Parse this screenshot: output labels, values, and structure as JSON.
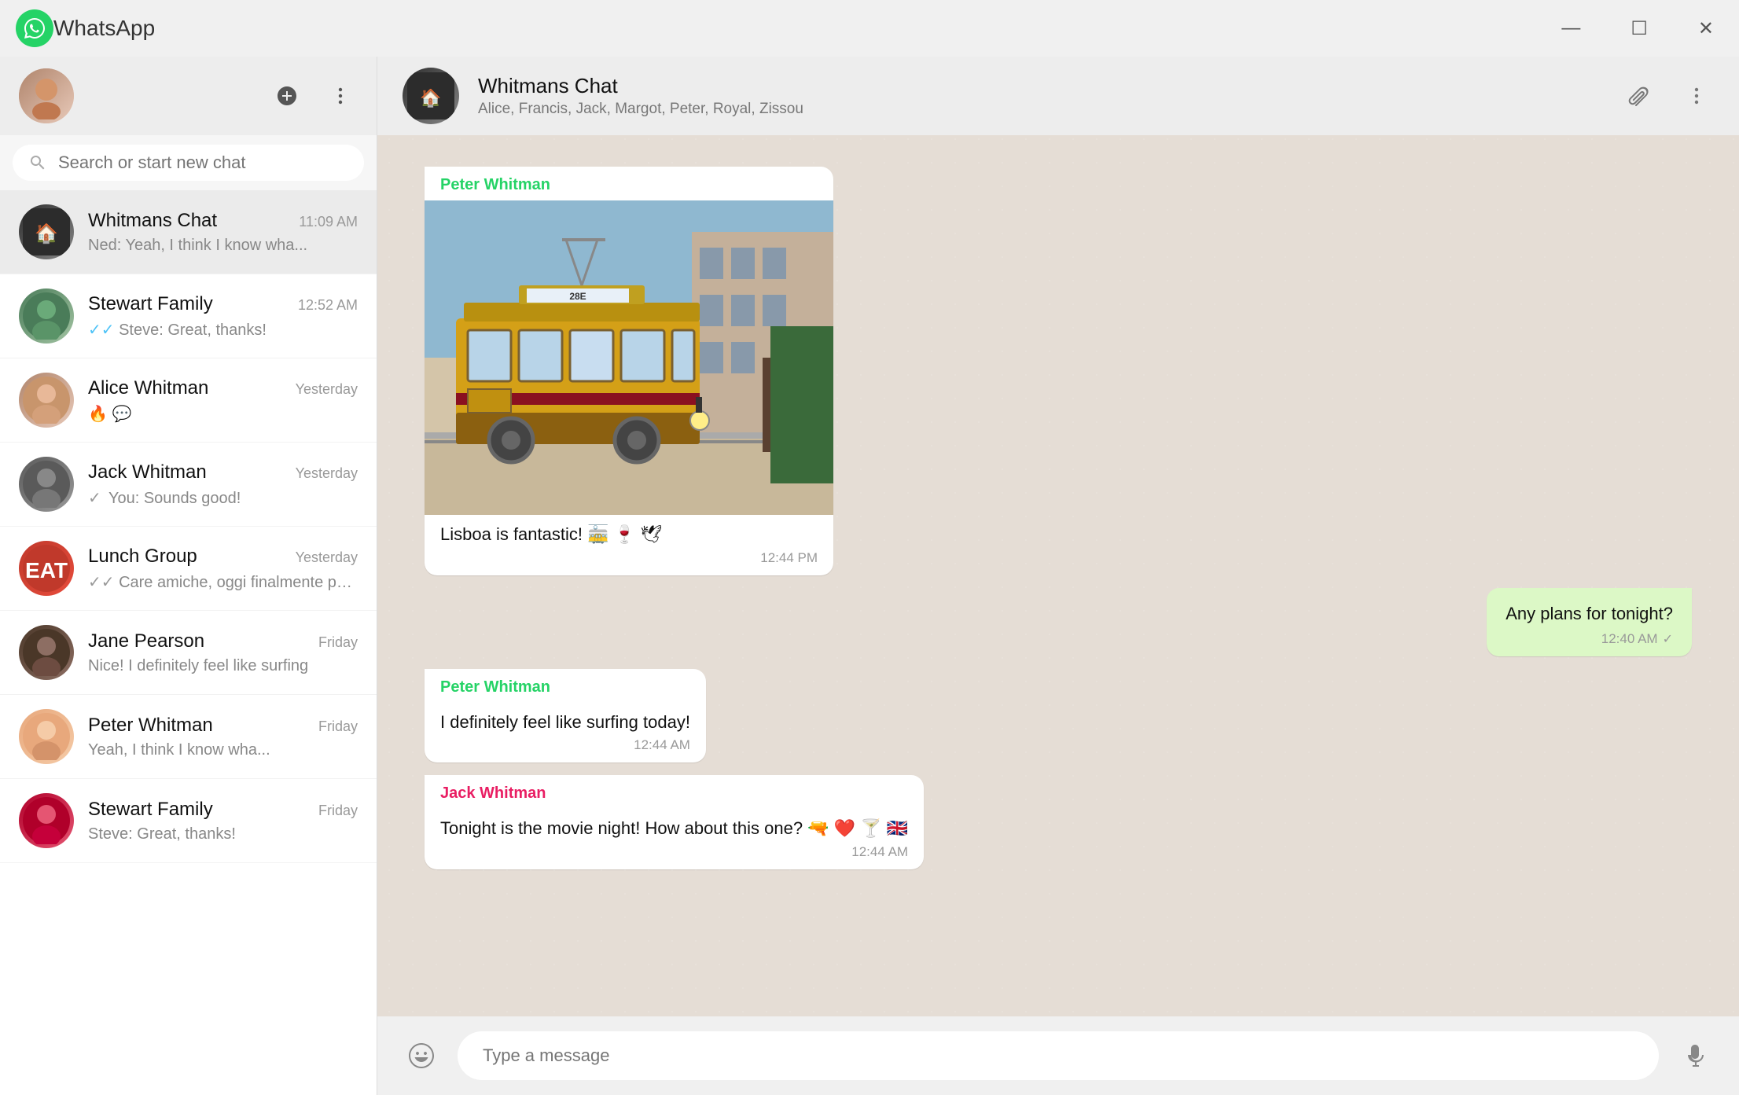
{
  "titlebar": {
    "title": "WhatsApp",
    "minimize": "—",
    "maximize": "☐",
    "close": "✕"
  },
  "sidebar": {
    "search_placeholder": "Search or start new chat",
    "new_chat_icon": "+",
    "more_icon": "···",
    "chats": [
      {
        "id": "whitmans",
        "name": "Whitmans Chat",
        "time": "11:09 AM",
        "preview": "Ned: Yeah, I think I know wha...",
        "tick": "none",
        "active": true
      },
      {
        "id": "stewart",
        "name": "Stewart Family",
        "time": "12:52 AM",
        "preview": "Steve: Great, thanks!",
        "tick": "double-blue"
      },
      {
        "id": "alice",
        "name": "Alice Whitman",
        "time": "Yesterday",
        "preview": "🔥 💬",
        "tick": "none"
      },
      {
        "id": "jack",
        "name": "Jack Whitman",
        "time": "Yesterday",
        "preview": "You: Sounds good!",
        "tick": "single-grey"
      },
      {
        "id": "lunch",
        "name": "Lunch Group",
        "time": "Yesterday",
        "preview": "Care amiche, oggi finalmente posso",
        "tick": "double-grey"
      },
      {
        "id": "jane",
        "name": "Jane Pearson",
        "time": "Friday",
        "preview": "Nice! I definitely feel like surfing",
        "tick": "none"
      },
      {
        "id": "peter",
        "name": "Peter Whitman",
        "time": "Friday",
        "preview": "Yeah, I think I know wha...",
        "tick": "none"
      },
      {
        "id": "stewart2",
        "name": "Stewart Family",
        "time": "Friday",
        "preview": "Steve: Great, thanks!",
        "tick": "none"
      }
    ]
  },
  "chat": {
    "name": "Whitmans Chat",
    "members": "Alice, Francis, Jack, Margot, Peter, Royal, Zissou",
    "messages": [
      {
        "id": "msg1",
        "type": "incoming",
        "sender": "Peter Whitman",
        "sender_color": "green",
        "has_image": true,
        "text": "Lisboa is fantastic! 🚋 🍷 🕊",
        "time": "12:44 PM"
      },
      {
        "id": "msg2",
        "type": "outgoing",
        "text": "Any plans for tonight?",
        "time": "12:40 AM",
        "tick": "✓"
      },
      {
        "id": "msg3",
        "type": "incoming",
        "sender": "Peter Whitman",
        "sender_color": "green",
        "text": "I definitely feel like surfing today!",
        "time": "12:44 AM"
      },
      {
        "id": "msg4",
        "type": "incoming",
        "sender": "Jack Whitman",
        "sender_color": "pink",
        "text": "Tonight is the movie night! How about this one? 🔫 ❤️ 🍸 🇬🇧",
        "time": "12:44 AM"
      }
    ],
    "input_placeholder": "Type a message"
  }
}
